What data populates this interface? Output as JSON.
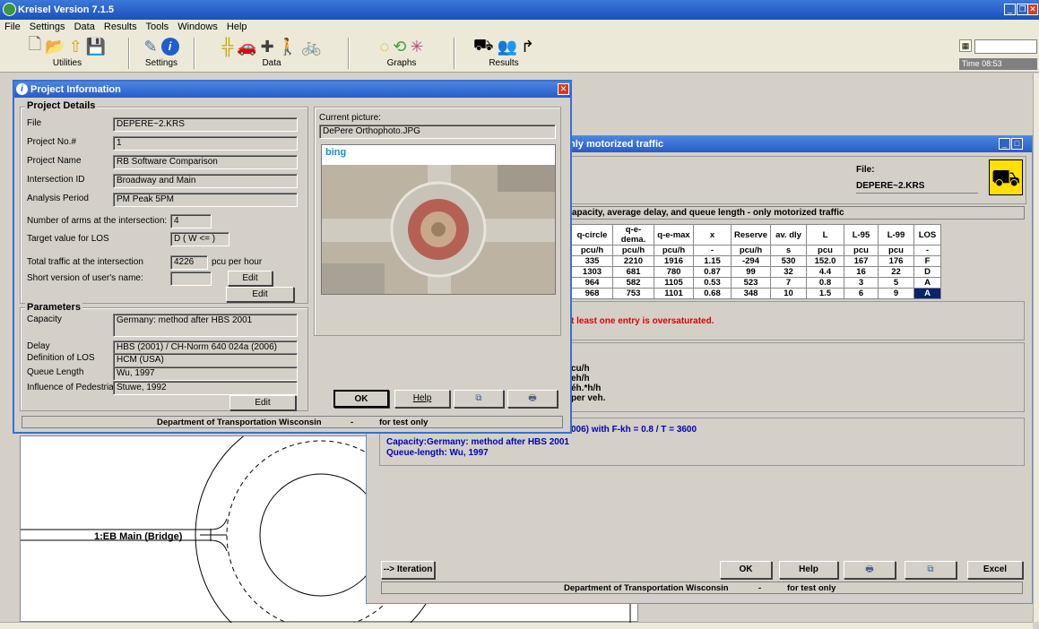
{
  "app": {
    "title": "Kreisel Version 7.1.5",
    "time": "Time 08:53"
  },
  "menu": [
    "File",
    "Settings",
    "Data",
    "Results",
    "Tools",
    "Windows",
    "Help"
  ],
  "toolbar": {
    "groups": [
      "Utilities",
      "Settings",
      "Data",
      "Graphs",
      "Results"
    ]
  },
  "project_info": {
    "title": "Project Information",
    "details_title": "Project Details",
    "fields": [
      {
        "label": "File",
        "value": "DEPERE~2.KRS"
      },
      {
        "label": "Project No.#",
        "value": "1"
      },
      {
        "label": "Project Name",
        "value": "RB Software Comparison"
      },
      {
        "label": "Intersection ID",
        "value": "Broadway and Main"
      },
      {
        "label": "Analysis Period",
        "value": "PM Peak 5PM"
      }
    ],
    "arms_label": "Number of arms at the intersection:",
    "arms_value": "4",
    "los_label": "Target value for LOS",
    "los_value": "D ( W <= )",
    "traffic_label": "Total traffic at the intersection",
    "traffic_value": "4226",
    "traffic_unit": "pcu per hour",
    "user_label": "Short version of user's name:",
    "user_value": "",
    "edit1": "Edit",
    "edit2": "Edit",
    "current_picture_label": "Current picture:",
    "current_picture": "DePere Orthophoto.JPG",
    "params_title": "Parameters",
    "params": [
      {
        "label": "Capacity",
        "value": "Germany: method after HBS 2001"
      },
      {
        "label": "Delay",
        "value": "HBS (2001) / CH-Norm 640 024a (2006)"
      },
      {
        "label": "Definition of LOS",
        "value": "HCM (USA)"
      },
      {
        "label": "Queue Length",
        "value": "Wu, 1997"
      },
      {
        "label": "Influence of Pedestrians",
        "value": "Stuwe, 1992"
      }
    ],
    "edit3": "Edit",
    "ok": "OK",
    "help": "Help",
    "status_left": "Department of Transportation  Wisconsin",
    "status_mid": "-",
    "status_right": "for test only"
  },
  "results": {
    "title": "nly motorized traffic",
    "file_label": "File:",
    "file_value": "DEPERE~2.KRS",
    "heading": "apacity, average delay, and queue length - only motorized traffic",
    "columns": [
      "q-circle",
      "q-e-dema.",
      "q-e-max",
      "x",
      "Reserve",
      "av. dly",
      "L",
      "L-95",
      "L-99",
      "LOS"
    ],
    "units": [
      "pcu/h",
      "pcu/h",
      "pcu/h",
      "-",
      "pcu/h",
      "s",
      "pcu",
      "pcu",
      "pcu",
      "-"
    ],
    "rows": [
      [
        "335",
        "2210",
        "1916",
        "1.15",
        "-294",
        "530",
        "152.0",
        "167",
        "176",
        "F"
      ],
      [
        "1303",
        "681",
        "780",
        "0.87",
        "99",
        "32",
        "4.4",
        "16",
        "22",
        "D"
      ],
      [
        "964",
        "582",
        "1105",
        "0.53",
        "523",
        "7",
        "0.8",
        "3",
        "5",
        "A"
      ],
      [
        "968",
        "753",
        "1101",
        "0.68",
        "348",
        "10",
        "1.5",
        "6",
        "9",
        "A"
      ]
    ],
    "warning": "t least one entry is oversaturated.",
    "units_lines": [
      "cu/h",
      "eh/h",
      "éh.*h/h",
      "per veh."
    ],
    "method1": "006) with F-kh = 0.8 / T = 3600",
    "method2": "Capacity:Germany: method after HBS 2001",
    "method3": "Queue-length: Wu, 1997",
    "iteration": "--> Iteration",
    "ok": "OK",
    "help": "Help",
    "excel": "Excel",
    "status_left": "Department of Transportation  Wisconsin",
    "status_mid": "-",
    "status_right": "for test only"
  },
  "drawing": {
    "arm_label": "1:EB Main (Bridge)"
  },
  "colors": {
    "title_blue": "#2a5cc6",
    "warning_red": "#e00000",
    "method_blue": "#0000c0",
    "los_selected": "#0a246a"
  }
}
